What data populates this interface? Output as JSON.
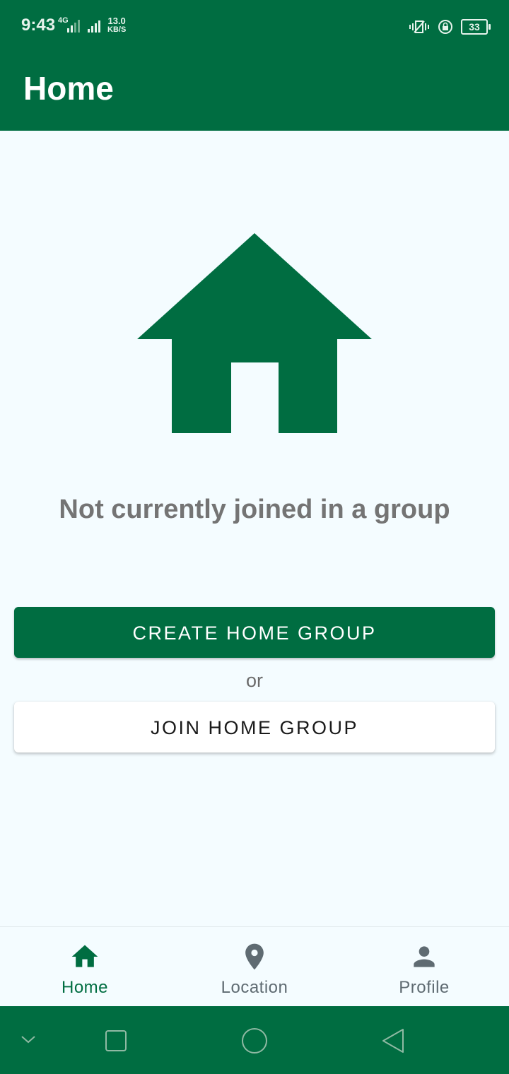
{
  "status_bar": {
    "time": "9:43",
    "network_type": "4G",
    "speed_value": "13.0",
    "speed_unit": "KB/S",
    "battery": "33"
  },
  "app_bar": {
    "title": "Home"
  },
  "main": {
    "hero_icon": "home-icon",
    "empty_message": "Not currently joined in a group",
    "create_button": "CREATE HOME GROUP",
    "or_text": "or",
    "join_button": "JOIN HOME GROUP"
  },
  "bottom_nav": {
    "items": [
      {
        "label": "Home",
        "icon": "home-icon",
        "active": true
      },
      {
        "label": "Location",
        "icon": "location-pin-icon",
        "active": false
      },
      {
        "label": "Profile",
        "icon": "person-icon",
        "active": false
      }
    ]
  },
  "colors": {
    "primary": "#006d41",
    "background": "#f4fcff",
    "inactive_nav": "#5f6b72",
    "message_text": "#747474"
  }
}
